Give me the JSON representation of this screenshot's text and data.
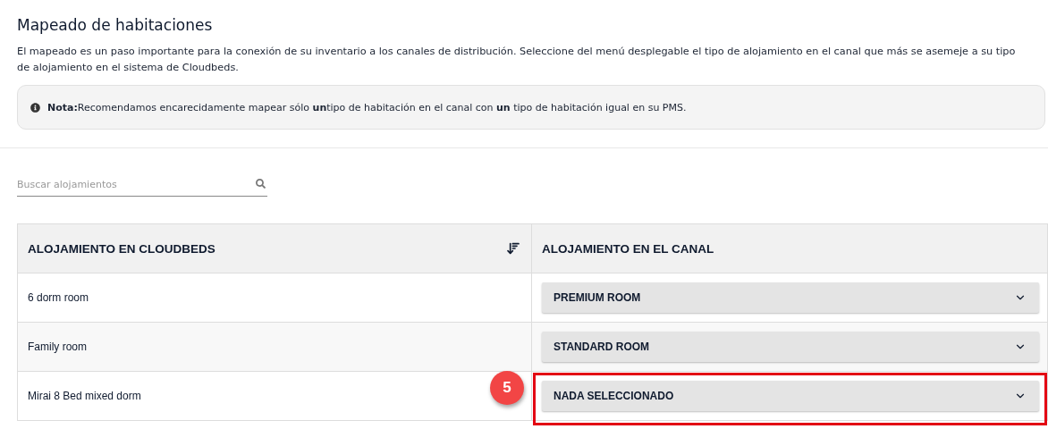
{
  "title": "Mapeado de habitaciones",
  "description": "El mapeado es un paso importante para la conexión de su inventario a los canales de distribución. Seleccione del menú desplegable el tipo de alojamiento en el canal que más se asemeje a su tipo de alojamiento en el sistema de Cloudbeds.",
  "note": "**Nota:**Recomendamos encarecidamente mapear sólo **un**tipo de habitación en el canal con **un** tipo de habitación igual en su PMS.",
  "search": {
    "placeholder": "Buscar alojamientos"
  },
  "table": {
    "columns": [
      "ALOJAMIENTO EN CLOUDBEDS",
      "ALOJAMIENTO EN EL CANAL"
    ],
    "rows": [
      {
        "name": "6 dorm room",
        "channel_room": "PREMIUM ROOM",
        "highlighted": false
      },
      {
        "name": "Family room",
        "channel_room": "STANDARD ROOM",
        "highlighted": false
      },
      {
        "name": "Mirai 8 Bed mixed dorm",
        "channel_room": "NADA SELECCIONADO",
        "highlighted": true,
        "callout": "5"
      }
    ]
  }
}
